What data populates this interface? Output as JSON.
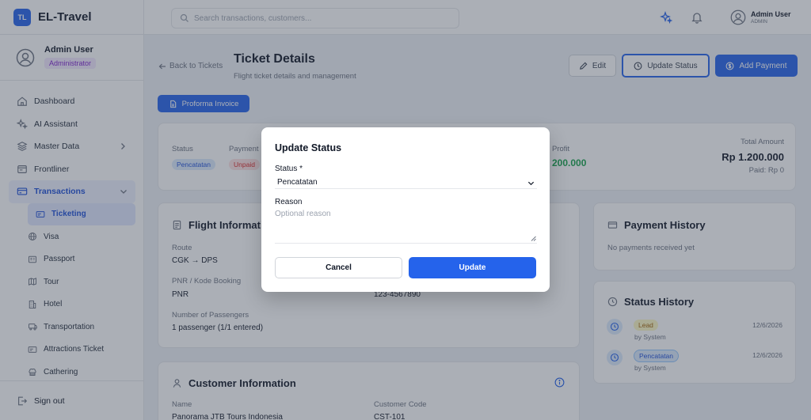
{
  "app": {
    "logo": "TL",
    "name": "EL-Travel"
  },
  "user": {
    "name": "Admin User",
    "role": "Administrator",
    "role_upper": "ADMIN"
  },
  "search": {
    "placeholder": "Search transactions, customers..."
  },
  "sidebar": {
    "items": [
      {
        "label": "Dashboard",
        "icon": "home-icon"
      },
      {
        "label": "AI Assistant",
        "icon": "sparkles-icon"
      },
      {
        "label": "Master Data",
        "icon": "database-icon"
      },
      {
        "label": "Frontliner",
        "icon": "window-icon"
      },
      {
        "label": "Transactions",
        "icon": "credit-card-icon"
      }
    ],
    "sub_items": [
      {
        "label": "Ticketing",
        "icon": "ticket-icon"
      },
      {
        "label": "Visa",
        "icon": "globe-icon"
      },
      {
        "label": "Passport",
        "icon": "passport-icon"
      },
      {
        "label": "Tour",
        "icon": "map-icon"
      },
      {
        "label": "Hotel",
        "icon": "building-icon"
      },
      {
        "label": "Transportation",
        "icon": "bus-icon"
      },
      {
        "label": "Attractions Ticket",
        "icon": "ticket-icon"
      },
      {
        "label": "Cathering",
        "icon": "chef-icon"
      }
    ],
    "signout": "Sign out"
  },
  "page": {
    "back": "Back to Tickets",
    "title": "Ticket Details",
    "subtitle": "Flight ticket details and management",
    "edit": "Edit",
    "update_status": "Update Status",
    "add_payment": "Add Payment",
    "proforma": "Proforma Invoice"
  },
  "summary": {
    "status_label": "Status",
    "status_value": "Pencatatan",
    "payment_label": "Payment",
    "payment_value": "Unpaid",
    "profit_label": "Profit",
    "profit_value": "200.000",
    "total_label": "Total Amount",
    "total_value": "Rp 1.200.000",
    "paid": "Paid: Rp 0"
  },
  "flight": {
    "title": "Flight Informatio",
    "route_label": "Route",
    "route_value": "CGK → DPS",
    "pnr_label": "PNR / Kode Booking",
    "pnr_value": "PNR",
    "phone_value": "123-4567890",
    "pax_label": "Number of Passengers",
    "pax_value": "1 passenger (1/1 entered)"
  },
  "payment_history": {
    "title": "Payment History",
    "empty": "No payments received yet"
  },
  "status_history": {
    "title": "Status History",
    "entries": [
      {
        "status": "Lead",
        "by": "by System",
        "date": "12/6/2026"
      },
      {
        "status": "Pencatatan",
        "by": "by System",
        "date": "12/6/2026"
      }
    ]
  },
  "customer": {
    "title": "Customer Information",
    "name_label": "Name",
    "name_value": "Panorama JTB Tours Indonesia",
    "code_label": "Customer Code",
    "code_value": "CST-101"
  },
  "modal": {
    "title": "Update Status",
    "status_label": "Status *",
    "status_value": "Pencatatan",
    "reason_label": "Reason",
    "reason_placeholder": "Optional reason",
    "cancel": "Cancel",
    "update": "Update"
  },
  "colors": {
    "accent": "#2563eb",
    "profit": "#16a34a",
    "unpaid": "#dc2626",
    "lead": "#ca8a04",
    "overlay": "rgba(55,65,81,0.42)"
  }
}
